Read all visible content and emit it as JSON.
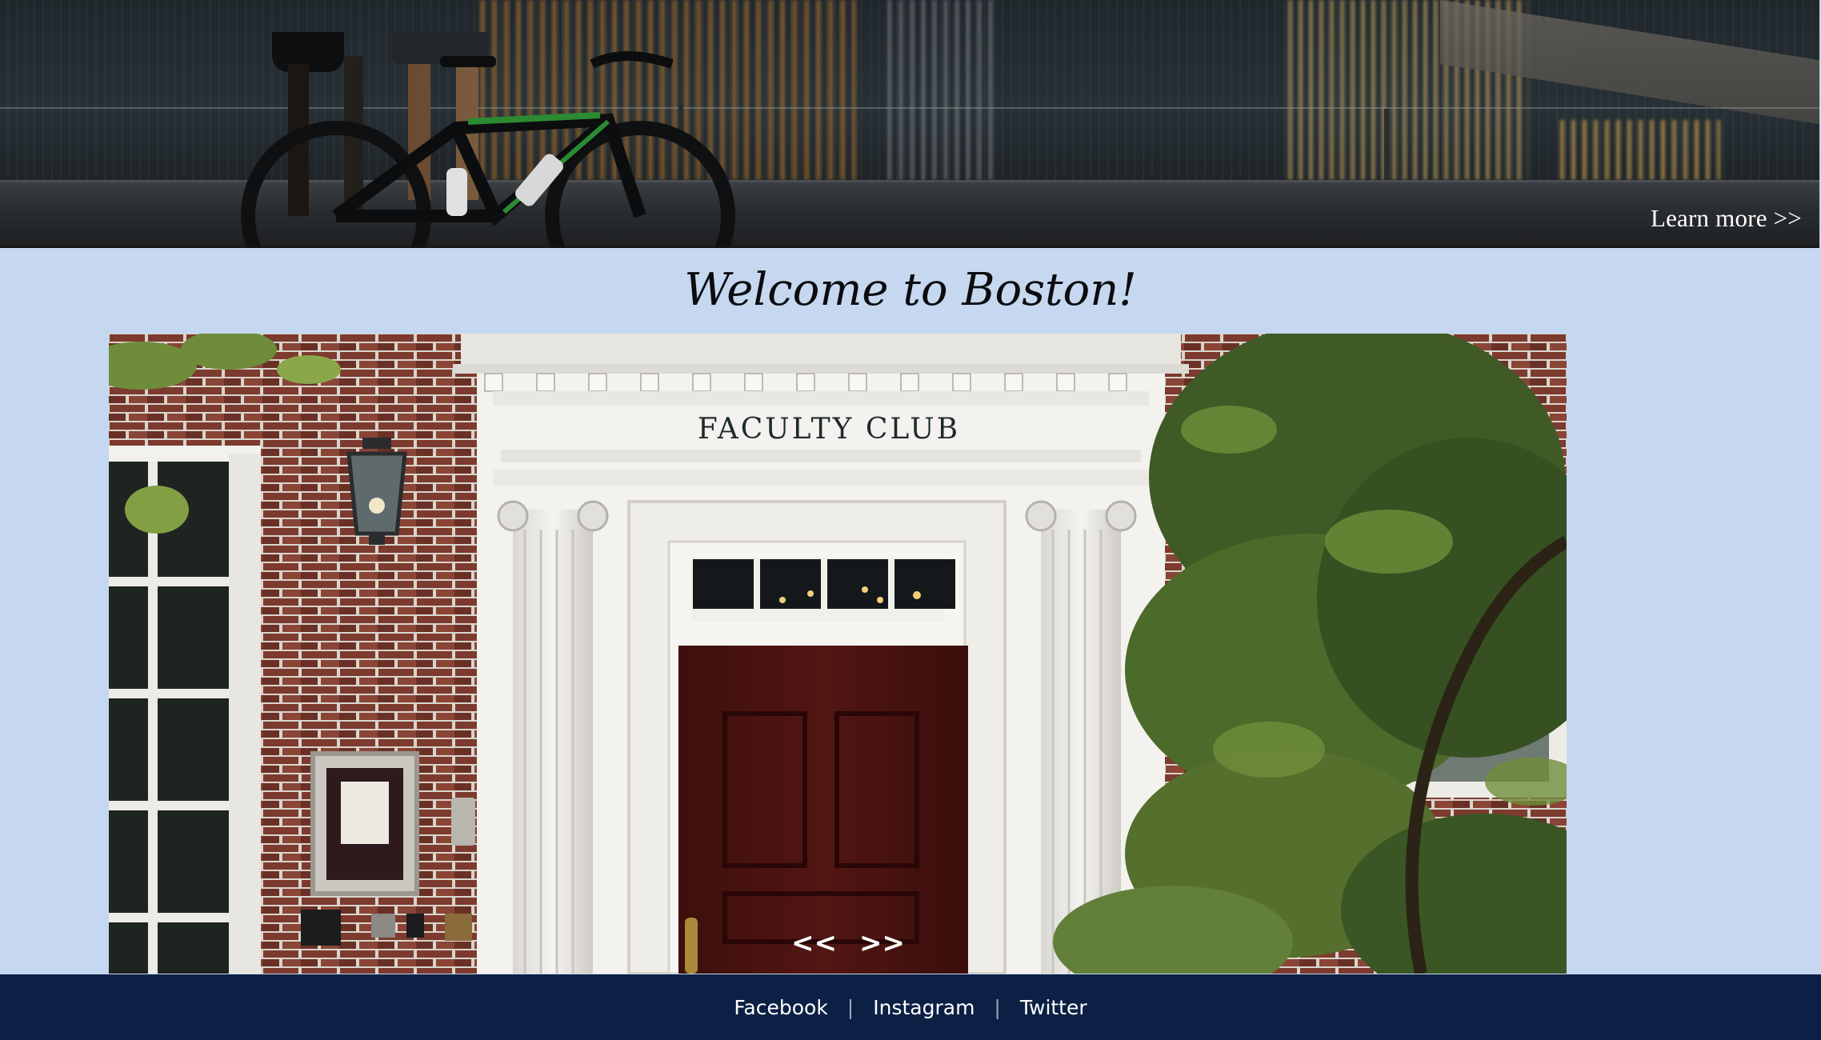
{
  "hero": {
    "cta_label": "Learn more >>"
  },
  "main": {
    "heading": "Welcome to Boston!",
    "carousel": {
      "sign_text": "FACULTY CLUB",
      "prev_label": "<<",
      "next_label": ">>"
    }
  },
  "footer": {
    "links": [
      "Facebook",
      "Instagram",
      "Twitter"
    ],
    "separator": "|"
  },
  "colors": {
    "page_background": "#c5d8ef",
    "footer_background": "#0b2044",
    "link_text": "#ffffff"
  }
}
